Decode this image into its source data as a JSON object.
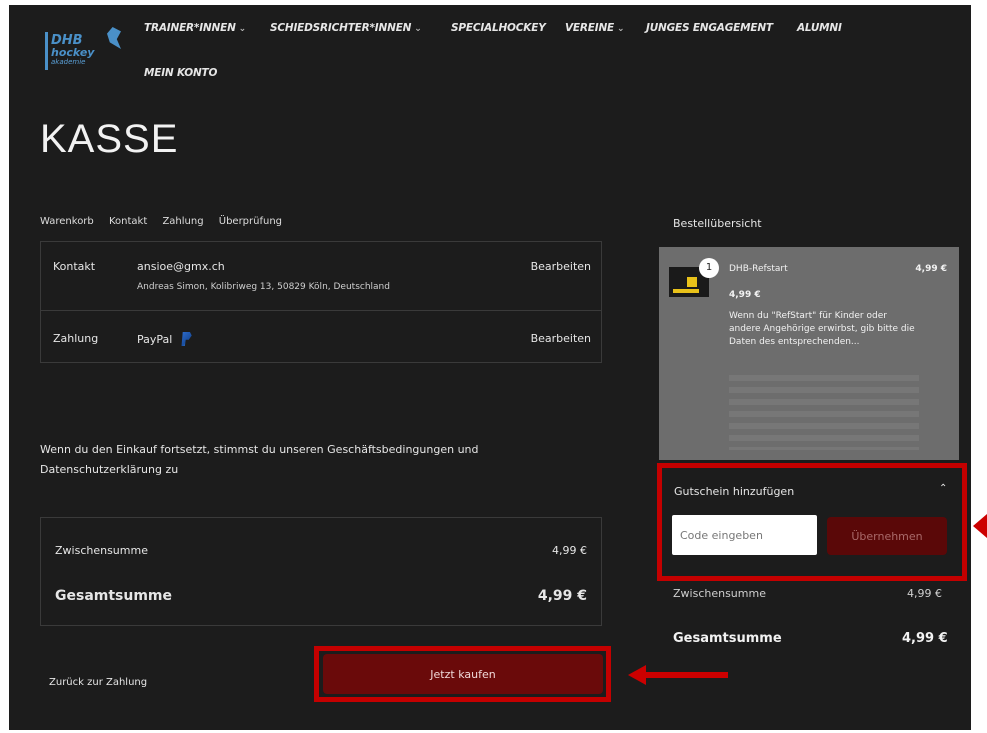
{
  "logo": {
    "line1": "DHB",
    "line2": "hockey",
    "line3": "akademie"
  },
  "nav": [
    {
      "label": "TRAINER*INNEN",
      "caret": "⌄"
    },
    {
      "label": "SCHIEDSRICHTER*INNEN",
      "caret": "⌄"
    },
    {
      "label": "SPECIALHOCKEY",
      "caret": ""
    },
    {
      "label": "VEREINE",
      "caret": "⌄"
    },
    {
      "label": "JUNGES ENGAGEMENT",
      "caret": ""
    },
    {
      "label": "ALUMNI",
      "caret": ""
    },
    {
      "label": "MEIN KONTO",
      "caret": ""
    }
  ],
  "page_title": "KASSE",
  "breadcrumb": [
    "Warenkorb",
    "Kontakt",
    "Zahlung",
    "Überprüfung"
  ],
  "contact": {
    "label": "Kontakt",
    "email": "ansioe@gmx.ch",
    "address": "Andreas Simon, Kolibriweg 13, 50829 Köln, Deutschland",
    "edit": "Bearbeiten"
  },
  "payment": {
    "label": "Zahlung",
    "method": "PayPal",
    "icon": "paypal-icon",
    "edit": "Bearbeiten"
  },
  "terms": "Wenn du den Einkauf fortsetzt, stimmst du unseren Geschäftsbedingungen und Datenschutzerklärung zu",
  "totals": {
    "subtotal_label": "Zwischensumme",
    "subtotal_value": "4,99 €",
    "total_label": "Gesamtsumme",
    "total_value": "4,99 €"
  },
  "back_link": "Zurück zur Zahlung",
  "buy_button": "Jetzt kaufen",
  "summary": {
    "title": "Bestellübersicht",
    "item": {
      "quantity": "1",
      "name": "DHB-Refstart",
      "price": "4,99 €",
      "unit_price": "4,99 €",
      "description": "Wenn du \"RefStart\" für Kinder oder andere Angehörige erwirbst, gib bitte die Daten des entsprechenden..."
    },
    "coupon": {
      "title": "Gutschein hinzufügen",
      "chevron": "⌃",
      "placeholder": "Code eingeben",
      "apply": "Übernehmen"
    },
    "subtotal_label": "Zwischensumme",
    "subtotal_value": "4,99 €",
    "total_label": "Gesamtsumme",
    "total_value": "4,99 €"
  },
  "colors": {
    "background": "#1c1c1c",
    "accent_red": "#c40000",
    "button_dark_red": "#6a0a0a",
    "link_blue": "#4a90c8"
  }
}
